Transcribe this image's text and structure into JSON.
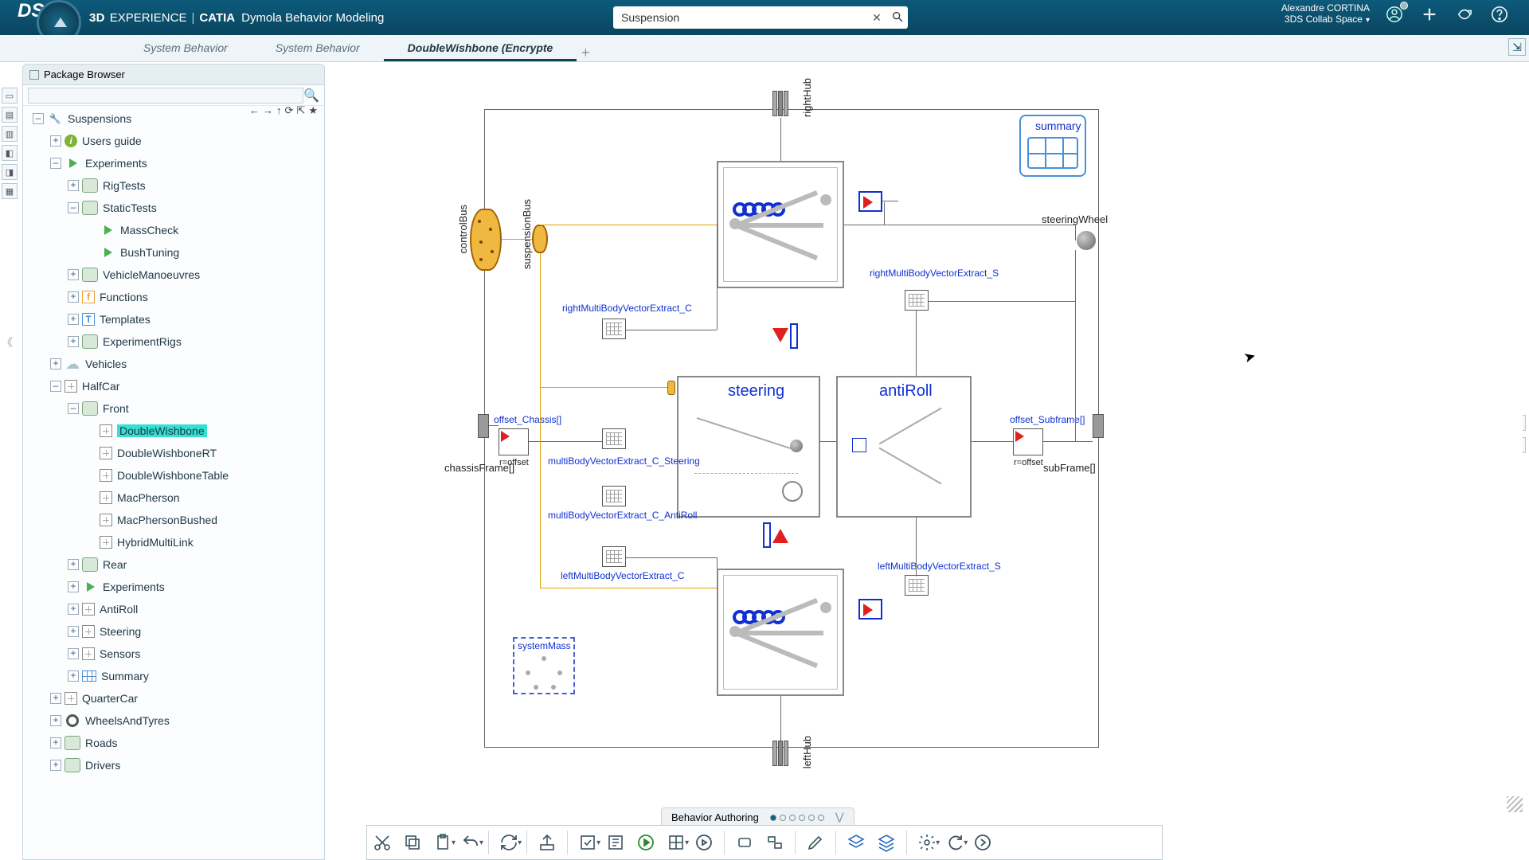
{
  "header": {
    "brand_3d": "3D",
    "brand_exp": "EXPERIENCE",
    "brand_sep": "|",
    "brand_prod": "CATIA",
    "brand_sub": "Dymola Behavior Modeling",
    "search_value": "Suspension",
    "user_name": "Alexandre CORTINA",
    "user_space": "3DS Collab Space"
  },
  "tabs": [
    {
      "label": "System Behavior",
      "active": false
    },
    {
      "label": "System Behavior",
      "active": false
    },
    {
      "label": "DoubleWishbone (Encrypte",
      "active": true
    }
  ],
  "pkg_title": "Package Browser",
  "tree_root": "Suspensions",
  "tree": {
    "users_guide": "Users guide",
    "experiments": "Experiments",
    "rigtests": "RigTests",
    "statictests": "StaticTests",
    "masscheck": "MassCheck",
    "bushtuning": "BushTuning",
    "vehman": "VehicleManoeuvres",
    "functions": "Functions",
    "templates": "Templates",
    "exprigs": "ExperimentRigs",
    "vehicles": "Vehicles",
    "halfcar": "HalfCar",
    "front": "Front",
    "dw": "DoubleWishbone",
    "dwrt": "DoubleWishboneRT",
    "dwtable": "DoubleWishboneTable",
    "macp": "MacPherson",
    "macpb": "MacPhersonBushed",
    "hybrid": "HybridMultiLink",
    "rear": "Rear",
    "experiments2": "Experiments",
    "antiroll": "AntiRoll",
    "steering": "Steering",
    "sensors": "Sensors",
    "summary": "Summary",
    "quartercar": "QuarterCar",
    "wheels": "WheelsAndTyres",
    "roads": "Roads",
    "drivers": "Drivers"
  },
  "canvas": {
    "righthub": "rightHub",
    "lefthub": "leftHub",
    "summary": "summary",
    "steeringwheel": "steeringWheel",
    "chassisframe": "chassisFrame[]",
    "subframe": "subFrame[]",
    "controlbus": "controlBus",
    "suspbus": "suspensionBus",
    "steering": "steering",
    "antiroll": "antiRoll",
    "offset_chassis": "offset_Chassis[]",
    "offset_subframe": "offset_Subframe[]",
    "rmve_c": "rightMultiBodyVectorExtract_C",
    "rmve_s": "rightMultiBodyVectorExtract_S",
    "lmve_c": "leftMultiBodyVectorExtract_C",
    "lmve_s": "leftMultiBodyVectorExtract_S",
    "mve_steer": "multiBodyVectorExtract_C_Steering",
    "mve_anti": "multiBodyVectorExtract_C_AntiRoll",
    "systemmass": "systemMass"
  },
  "strip": {
    "label": "Behavior Authoring"
  }
}
